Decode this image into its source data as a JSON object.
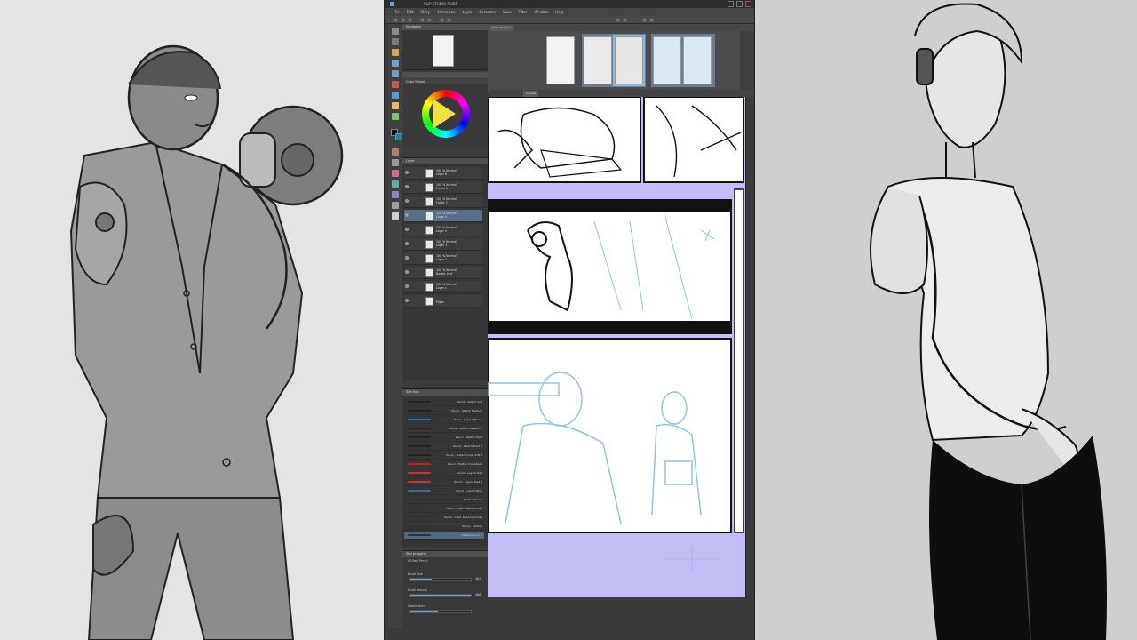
{
  "app": {
    "title": "CLIP STUDIO PAINT",
    "menu": [
      "File",
      "Edit",
      "Story",
      "Animation",
      "Layer",
      "Selection",
      "View",
      "Filter",
      "Window",
      "Help"
    ]
  },
  "panels": {
    "navigator": "Navigator",
    "color": "Color Wheel",
    "layer": "Layer",
    "subtool": "Sub Tool",
    "tool_property": "Tool property",
    "page_manager": "Page Manager",
    "canvas_tab": "Canvas"
  },
  "layers": [
    {
      "name": "100 % Normal",
      "sub": "Layer 8",
      "selected": false
    },
    {
      "name": "100 % Normal",
      "sub": "Frame 1",
      "selected": false
    },
    {
      "name": "100 % Normal",
      "sub": "Folder 1",
      "selected": false
    },
    {
      "name": "100 % Normal",
      "sub": "Layer 4",
      "selected": true
    },
    {
      "name": "100 % Normal",
      "sub": "Layer 5",
      "selected": false
    },
    {
      "name": "100 % Normal",
      "sub": "Layer 3",
      "selected": false
    },
    {
      "name": "100 % Normal",
      "sub": "Layer 2",
      "selected": false
    },
    {
      "name": "100 % Normal",
      "sub": "Border Line",
      "selected": false
    },
    {
      "name": "100 % Normal",
      "sub": "Layer 1",
      "selected": false
    },
    {
      "name": "",
      "sub": "Paper",
      "selected": false
    }
  ],
  "brushes": [
    {
      "name": "Pencil - Sketch Soft",
      "color": "#222222"
    },
    {
      "name": "Pencil - Sketch Medium",
      "color": "#222222"
    },
    {
      "name": "Pencil - Layout Blue 2",
      "color": "#2a6fb0"
    },
    {
      "name": "Pencil - Sketch Medium 2",
      "color": "#222222"
    },
    {
      "name": "Pencil - Sketch Hard",
      "color": "#222222"
    },
    {
      "name": "Pencil - Sketch Hard 2",
      "color": "#222222"
    },
    {
      "name": "Pencil - Bubble Draw Soft 2",
      "color": "#222222"
    },
    {
      "name": "Pencil - Flatten 0 Gradient",
      "color": "#c02020"
    },
    {
      "name": "Pencil - Layout Red",
      "color": "#d03030"
    },
    {
      "name": "Pencil - Layout Red 2",
      "color": "#d03030"
    },
    {
      "name": "Pencil - Layout Blue",
      "color": "#2a6fb0"
    },
    {
      "name": "CS Real Pencil",
      "color": "#333333"
    },
    {
      "name": "Pencil - Clear Shadow Liner",
      "color": "#333333"
    },
    {
      "name": "Pencil - Clear Shadow Dense",
      "color": "#333333"
    },
    {
      "name": "Pencil - Outline",
      "color": "#333333"
    },
    {
      "name": "CS Real Pencil 2",
      "color": "#333333"
    }
  ],
  "tool_property": {
    "brush_name": "CS Real Pencil",
    "brush_size_label": "Brush Size",
    "brush_size": "10.0",
    "brush_size_level": 0.35,
    "density_label": "Brush density",
    "density": "100",
    "density_level": 1.0,
    "stabilization_label": "Stabilization",
    "stabilization_level": 0.45
  },
  "colors": {
    "foreground": "#111111",
    "background": "#0a8fb0",
    "selection": "#5a6f86",
    "page_bg": "#c2bdf5",
    "sketch_blue": "#8fc4dd"
  }
}
